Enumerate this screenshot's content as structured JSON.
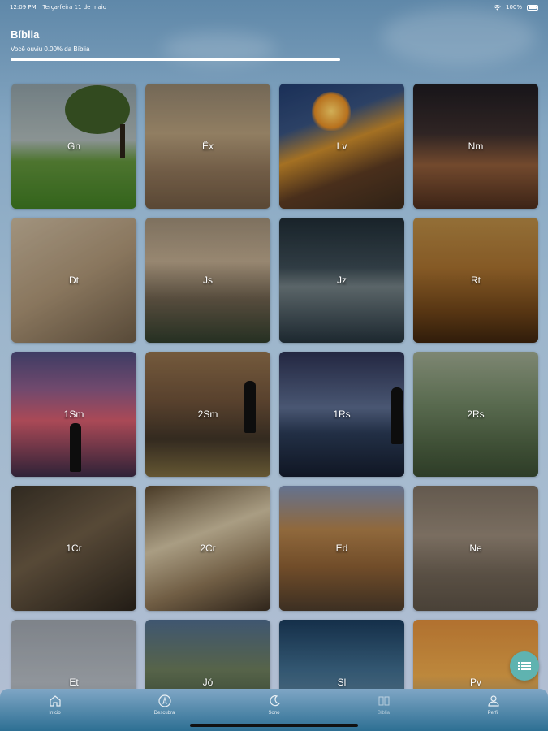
{
  "status_bar": {
    "time": "12:09 PM",
    "date": "Terça-feira 11 de maio",
    "battery": "100%"
  },
  "header": {
    "title": "Bíblia",
    "subtitle": "Você ouviu 0.00% da Bíblia",
    "progress_percent": 0
  },
  "books": [
    {
      "label": "Gn"
    },
    {
      "label": "Êx"
    },
    {
      "label": "Lv"
    },
    {
      "label": "Nm"
    },
    {
      "label": "Dt"
    },
    {
      "label": "Js"
    },
    {
      "label": "Jz"
    },
    {
      "label": "Rt"
    },
    {
      "label": "1Sm"
    },
    {
      "label": "2Sm"
    },
    {
      "label": "1Rs"
    },
    {
      "label": "2Rs"
    },
    {
      "label": "1Cr"
    },
    {
      "label": "2Cr"
    },
    {
      "label": "Ed"
    },
    {
      "label": "Ne"
    },
    {
      "label": "Et"
    },
    {
      "label": "Jó"
    },
    {
      "label": "Sl"
    },
    {
      "label": "Pv"
    }
  ],
  "bottom_nav": [
    {
      "label": "Início",
      "icon": "home-icon"
    },
    {
      "label": "Descubra",
      "icon": "compass-icon"
    },
    {
      "label": "Sono",
      "icon": "moon-icon"
    },
    {
      "label": "Bíblia",
      "icon": "bible-icon",
      "active": true
    },
    {
      "label": "Perfil",
      "icon": "profile-icon"
    }
  ],
  "colors": {
    "accent": "#5fb3b0",
    "nav_bottom": "#2d6f93"
  }
}
